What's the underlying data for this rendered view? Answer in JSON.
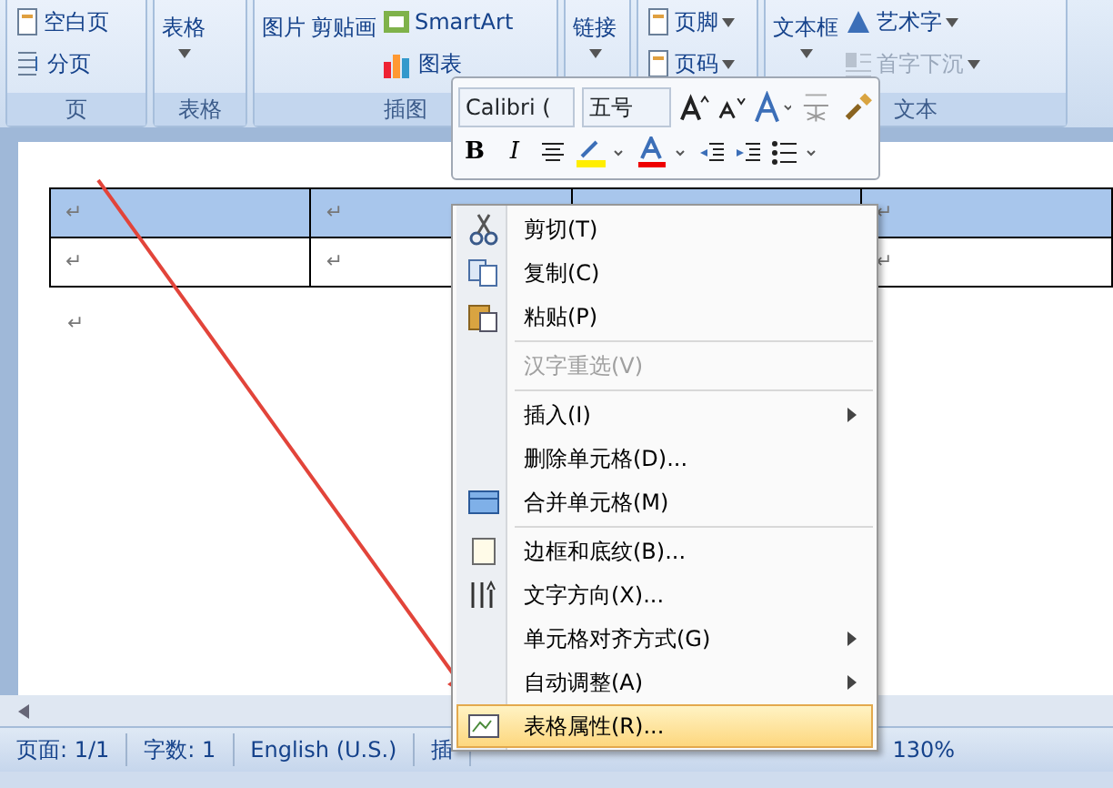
{
  "ribbon": {
    "groups": [
      {
        "label": "页",
        "items": [
          {
            "text": "空白页",
            "kind": "small"
          },
          {
            "text": "分页",
            "kind": "small"
          }
        ]
      },
      {
        "label": "表格",
        "items": [
          {
            "text": "表格",
            "kind": "large",
            "dropdown": true
          }
        ]
      },
      {
        "label": "插图",
        "items": [
          {
            "text": "图片",
            "kind": "large"
          },
          {
            "text": "剪贴画",
            "kind": "large"
          },
          {
            "text": "SmartArt",
            "kind": "small"
          },
          {
            "text": "图表",
            "kind": "small"
          }
        ]
      },
      {
        "items": [
          {
            "text": "链接",
            "kind": "large",
            "dropdown": true
          }
        ]
      },
      {
        "items": [
          {
            "text": "页脚",
            "kind": "small",
            "dropdown": true
          },
          {
            "text": "页码",
            "kind": "small",
            "dropdown": true
          }
        ]
      },
      {
        "label": "文本",
        "items": [
          {
            "text": "文本框",
            "kind": "large",
            "dropdown": true
          },
          {
            "text": "艺术字",
            "kind": "small",
            "dropdown": true
          },
          {
            "text": "首字下沉",
            "kind": "small",
            "dropdown": true,
            "disabled": true
          }
        ]
      }
    ]
  },
  "mini_toolbar": {
    "font": "Calibri (",
    "size": "五号",
    "bold": "B",
    "italic": "I"
  },
  "document": {
    "table": {
      "rows": [
        {
          "selected": true,
          "cells": [
            "↵",
            "↵",
            null,
            "↵"
          ]
        },
        {
          "selected": false,
          "cells": [
            "↵",
            "↵",
            null,
            "↵"
          ]
        }
      ]
    },
    "after_table": "↵"
  },
  "context_menu": {
    "items": [
      {
        "kind": "item",
        "label": "剪切(T)",
        "disabled": false,
        "submenu": false,
        "selected": false
      },
      {
        "kind": "item",
        "label": "复制(C)",
        "disabled": false,
        "submenu": false,
        "selected": false
      },
      {
        "kind": "item",
        "label": "粘贴(P)",
        "disabled": false,
        "submenu": false,
        "selected": false
      },
      {
        "kind": "separator"
      },
      {
        "kind": "item",
        "label": "汉字重选(V)",
        "disabled": true,
        "submenu": false,
        "selected": false
      },
      {
        "kind": "separator"
      },
      {
        "kind": "item",
        "label": "插入(I)",
        "disabled": false,
        "submenu": true,
        "selected": false
      },
      {
        "kind": "item",
        "label": "删除单元格(D)...",
        "disabled": false,
        "submenu": false,
        "selected": false
      },
      {
        "kind": "item",
        "label": "合并单元格(M)",
        "disabled": false,
        "submenu": false,
        "selected": false
      },
      {
        "kind": "separator"
      },
      {
        "kind": "item",
        "label": "边框和底纹(B)...",
        "disabled": false,
        "submenu": false,
        "selected": false
      },
      {
        "kind": "item",
        "label": "文字方向(X)...",
        "disabled": false,
        "submenu": false,
        "selected": false
      },
      {
        "kind": "item",
        "label": "单元格对齐方式(G)",
        "disabled": false,
        "submenu": true,
        "selected": false
      },
      {
        "kind": "item",
        "label": "自动调整(A)",
        "disabled": false,
        "submenu": true,
        "selected": false
      },
      {
        "kind": "item",
        "label": "表格属性(R)...",
        "disabled": false,
        "submenu": false,
        "selected": true
      }
    ]
  },
  "status_bar": {
    "items": [
      "页面: 1/1",
      "字数: 1",
      "English (U.S.)",
      "插"
    ],
    "zoom": "130%"
  }
}
